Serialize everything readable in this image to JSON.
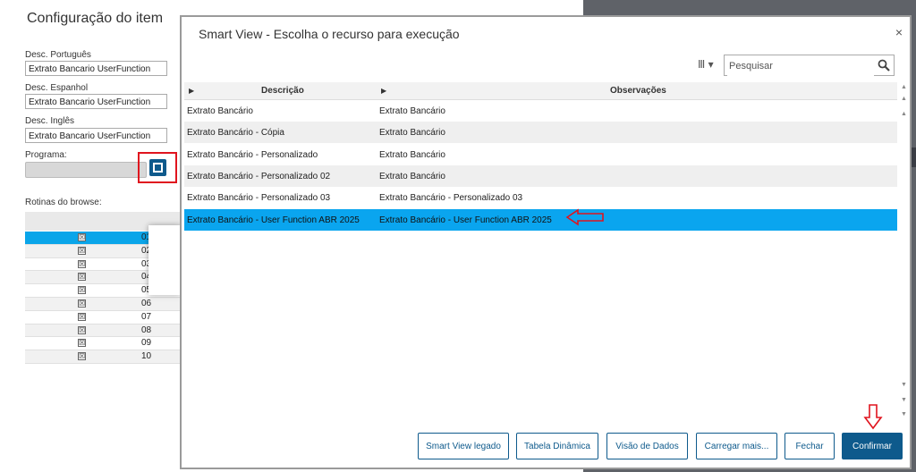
{
  "background_form": {
    "title": "Configuração do item",
    "desc_portugues_label": "Desc. Português",
    "desc_portugues_value": "Extrato Bancario UserFunction",
    "desc_espanhol_label": "Desc. Espanhol",
    "desc_espanhol_value": "Extrato Bancario UserFunction",
    "desc_ingles_label": "Desc. Inglês",
    "desc_ingles_value": "Extrato Bancario UserFunction",
    "programa_label": "Programa:",
    "rotinas_label": "Rotinas do browse:",
    "rotinas_rows": [
      "01",
      "02",
      "03",
      "04",
      "05",
      "06",
      "07",
      "08",
      "09",
      "10"
    ],
    "checkbox_glyph": "☒"
  },
  "dialog": {
    "title": "Smart View - Escolha o recurso para execução",
    "close_glyph": "×",
    "columns_glyph": "Ⅲ ▾",
    "search_placeholder": "Pesquisar",
    "columns": [
      "Descrição",
      "Observações"
    ],
    "rows": [
      {
        "descricao": "Extrato Bancário",
        "observacoes": "Extrato Bancário"
      },
      {
        "descricao": "Extrato Bancário - Cópia",
        "observacoes": "Extrato Bancário"
      },
      {
        "descricao": "Extrato Bancário - Personalizado",
        "observacoes": "Extrato Bancário"
      },
      {
        "descricao": "Extrato Bancário - Personalizado 02",
        "observacoes": "Extrato Bancário"
      },
      {
        "descricao": "Extrato Bancário - Personalizado 03",
        "observacoes": "Extrato Bancário - Personalizado 03"
      },
      {
        "descricao": "Extrato Bancário - User Function ABR 2025",
        "observacoes": "Extrato Bancário - User Function ABR 2025"
      }
    ],
    "selected_row": 5,
    "buttons": {
      "smart_view_legado": "Smart View legado",
      "tabela_dinamica": "Tabela Dinâmica",
      "visao_de_dados": "Visão de Dados",
      "carregar_mais": "Carregar mais...",
      "fechar": "Fechar",
      "confirmar": "Confirmar"
    }
  },
  "colors": {
    "accent": "#0e5a8c",
    "selection": "#0aa5ef",
    "annotation_red": "#e0141e"
  }
}
